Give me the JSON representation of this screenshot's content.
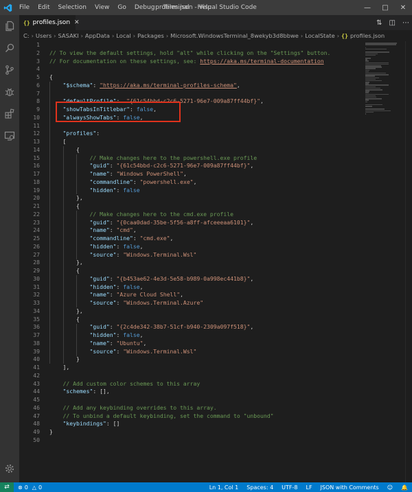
{
  "window": {
    "title": "profiles.json - Visual Studio Code",
    "menu": [
      "File",
      "Edit",
      "Selection",
      "View",
      "Go",
      "Debug",
      "Terminal",
      "Help"
    ]
  },
  "tab": {
    "label": "profiles.json",
    "icon": "{}"
  },
  "breadcrumb": [
    "C:",
    "Users",
    "SASAKI",
    "AppData",
    "Local",
    "Packages",
    "Microsoft.WindowsTerminal_8wekyb3d8bbwe",
    "LocalState",
    "profiles.json"
  ],
  "code_lines": [
    [],
    [
      [
        "comment",
        "// To view the default settings, hold \"alt\" while clicking on the \"Settings\" button."
      ]
    ],
    [
      [
        "comment",
        "// For documentation on these settings, see: "
      ],
      [
        "link",
        "https://aka.ms/terminal-documentation"
      ]
    ],
    [],
    [
      [
        "punc",
        "{"
      ]
    ],
    [
      [
        "punc",
        "    "
      ],
      [
        "key",
        "\"$schema\""
      ],
      [
        "punc",
        ": "
      ],
      [
        "link",
        "\"https://aka.ms/terminal-profiles-schema\""
      ],
      [
        "punc",
        ","
      ]
    ],
    [],
    [
      [
        "punc",
        "    "
      ],
      [
        "key",
        "\"defaultProfile\""
      ],
      [
        "punc",
        ":  "
      ],
      [
        "str",
        "\"{61c54bbd-c2c6-5271-96e7-009a87ff44bf}\""
      ],
      [
        "punc",
        ","
      ]
    ],
    [
      [
        "punc",
        "    "
      ],
      [
        "key",
        "\"showTabsInTitlebar\""
      ],
      [
        "punc",
        ": "
      ],
      [
        "kw",
        "false"
      ],
      [
        "punc",
        ","
      ]
    ],
    [
      [
        "punc",
        "    "
      ],
      [
        "key",
        "\"alwaysShowTabs\""
      ],
      [
        "punc",
        ": "
      ],
      [
        "kw",
        "false"
      ],
      [
        "punc",
        ","
      ]
    ],
    [],
    [
      [
        "punc",
        "    "
      ],
      [
        "key",
        "\"profiles\""
      ],
      [
        "punc",
        ":"
      ]
    ],
    [
      [
        "punc",
        "    ["
      ]
    ],
    [
      [
        "punc",
        "        {"
      ]
    ],
    [
      [
        "punc",
        "            "
      ],
      [
        "comment",
        "// Make changes here to the powershell.exe profile"
      ]
    ],
    [
      [
        "punc",
        "            "
      ],
      [
        "key",
        "\"guid\""
      ],
      [
        "punc",
        ": "
      ],
      [
        "str",
        "\"{61c54bbd-c2c6-5271-96e7-009a87ff44bf}\""
      ],
      [
        "punc",
        ","
      ]
    ],
    [
      [
        "punc",
        "            "
      ],
      [
        "key",
        "\"name\""
      ],
      [
        "punc",
        ": "
      ],
      [
        "str",
        "\"Windows PowerShell\""
      ],
      [
        "punc",
        ","
      ]
    ],
    [
      [
        "punc",
        "            "
      ],
      [
        "key",
        "\"commandline\""
      ],
      [
        "punc",
        ": "
      ],
      [
        "str",
        "\"powershell.exe\""
      ],
      [
        "punc",
        ","
      ]
    ],
    [
      [
        "punc",
        "            "
      ],
      [
        "key",
        "\"hidden\""
      ],
      [
        "punc",
        ": "
      ],
      [
        "kw",
        "false"
      ]
    ],
    [
      [
        "punc",
        "        },"
      ]
    ],
    [
      [
        "punc",
        "        {"
      ]
    ],
    [
      [
        "punc",
        "            "
      ],
      [
        "comment",
        "// Make changes here to the cmd.exe profile"
      ]
    ],
    [
      [
        "punc",
        "            "
      ],
      [
        "key",
        "\"guid\""
      ],
      [
        "punc",
        ": "
      ],
      [
        "str",
        "\"{0caa0dad-35be-5f56-a8ff-afceeeaa6101}\""
      ],
      [
        "punc",
        ","
      ]
    ],
    [
      [
        "punc",
        "            "
      ],
      [
        "key",
        "\"name\""
      ],
      [
        "punc",
        ": "
      ],
      [
        "str",
        "\"cmd\""
      ],
      [
        "punc",
        ","
      ]
    ],
    [
      [
        "punc",
        "            "
      ],
      [
        "key",
        "\"commandline\""
      ],
      [
        "punc",
        ": "
      ],
      [
        "str",
        "\"cmd.exe\""
      ],
      [
        "punc",
        ","
      ]
    ],
    [
      [
        "punc",
        "            "
      ],
      [
        "key",
        "\"hidden\""
      ],
      [
        "punc",
        ": "
      ],
      [
        "kw",
        "false"
      ],
      [
        "punc",
        ","
      ]
    ],
    [
      [
        "punc",
        "            "
      ],
      [
        "key",
        "\"source\""
      ],
      [
        "punc",
        ": "
      ],
      [
        "str",
        "\"Windows.Terminal.Wsl\""
      ]
    ],
    [
      [
        "punc",
        "        },"
      ]
    ],
    [
      [
        "punc",
        "        {"
      ]
    ],
    [
      [
        "punc",
        "            "
      ],
      [
        "key",
        "\"guid\""
      ],
      [
        "punc",
        ": "
      ],
      [
        "str",
        "\"{b453ae62-4e3d-5e58-b989-0a998ec441b8}\""
      ],
      [
        "punc",
        ","
      ]
    ],
    [
      [
        "punc",
        "            "
      ],
      [
        "key",
        "\"hidden\""
      ],
      [
        "punc",
        ": "
      ],
      [
        "kw",
        "false"
      ],
      [
        "punc",
        ","
      ]
    ],
    [
      [
        "punc",
        "            "
      ],
      [
        "key",
        "\"name\""
      ],
      [
        "punc",
        ": "
      ],
      [
        "str",
        "\"Azure Cloud Shell\""
      ],
      [
        "punc",
        ","
      ]
    ],
    [
      [
        "punc",
        "            "
      ],
      [
        "key",
        "\"source\""
      ],
      [
        "punc",
        ": "
      ],
      [
        "str",
        "\"Windows.Terminal.Azure\""
      ]
    ],
    [
      [
        "punc",
        "        },"
      ]
    ],
    [
      [
        "punc",
        "        {"
      ]
    ],
    [
      [
        "punc",
        "            "
      ],
      [
        "key",
        "\"guid\""
      ],
      [
        "punc",
        ": "
      ],
      [
        "str",
        "\"{2c4de342-38b7-51cf-b940-2309a097f518}\""
      ],
      [
        "punc",
        ","
      ]
    ],
    [
      [
        "punc",
        "            "
      ],
      [
        "key",
        "\"hidden\""
      ],
      [
        "punc",
        ": "
      ],
      [
        "kw",
        "false"
      ],
      [
        "punc",
        ","
      ]
    ],
    [
      [
        "punc",
        "            "
      ],
      [
        "key",
        "\"name\""
      ],
      [
        "punc",
        ": "
      ],
      [
        "str",
        "\"Ubuntu\""
      ],
      [
        "punc",
        ","
      ]
    ],
    [
      [
        "punc",
        "            "
      ],
      [
        "key",
        "\"source\""
      ],
      [
        "punc",
        ": "
      ],
      [
        "str",
        "\"Windows.Terminal.Wsl\""
      ]
    ],
    [
      [
        "punc",
        "        }"
      ]
    ],
    [
      [
        "punc",
        "    ],"
      ]
    ],
    [],
    [
      [
        "punc",
        "    "
      ],
      [
        "comment",
        "// Add custom color schemes to this array"
      ]
    ],
    [
      [
        "punc",
        "    "
      ],
      [
        "key",
        "\"schemes\""
      ],
      [
        "punc",
        ": [],"
      ]
    ],
    [],
    [
      [
        "punc",
        "    "
      ],
      [
        "comment",
        "// Add any keybinding overrides to this array."
      ]
    ],
    [
      [
        "punc",
        "    "
      ],
      [
        "comment",
        "// To unbind a default keybinding, set the command to \"unbound\""
      ]
    ],
    [
      [
        "punc",
        "    "
      ],
      [
        "key",
        "\"keybindings\""
      ],
      [
        "punc",
        ": []"
      ]
    ],
    [
      [
        "punc",
        "}"
      ]
    ],
    []
  ],
  "status": {
    "errors": "0",
    "warnings": "0",
    "position": "Ln 1, Col 1",
    "spaces": "Spaces: 4",
    "encoding": "UTF-8",
    "eol": "LF",
    "language": "JSON with Comments"
  },
  "colors": {
    "titlebar": "#3c3c3c",
    "activitybar": "#333333",
    "editor_bg": "#1e1e1e",
    "statusbar": "#007acc",
    "highlight": "#e0321c"
  }
}
